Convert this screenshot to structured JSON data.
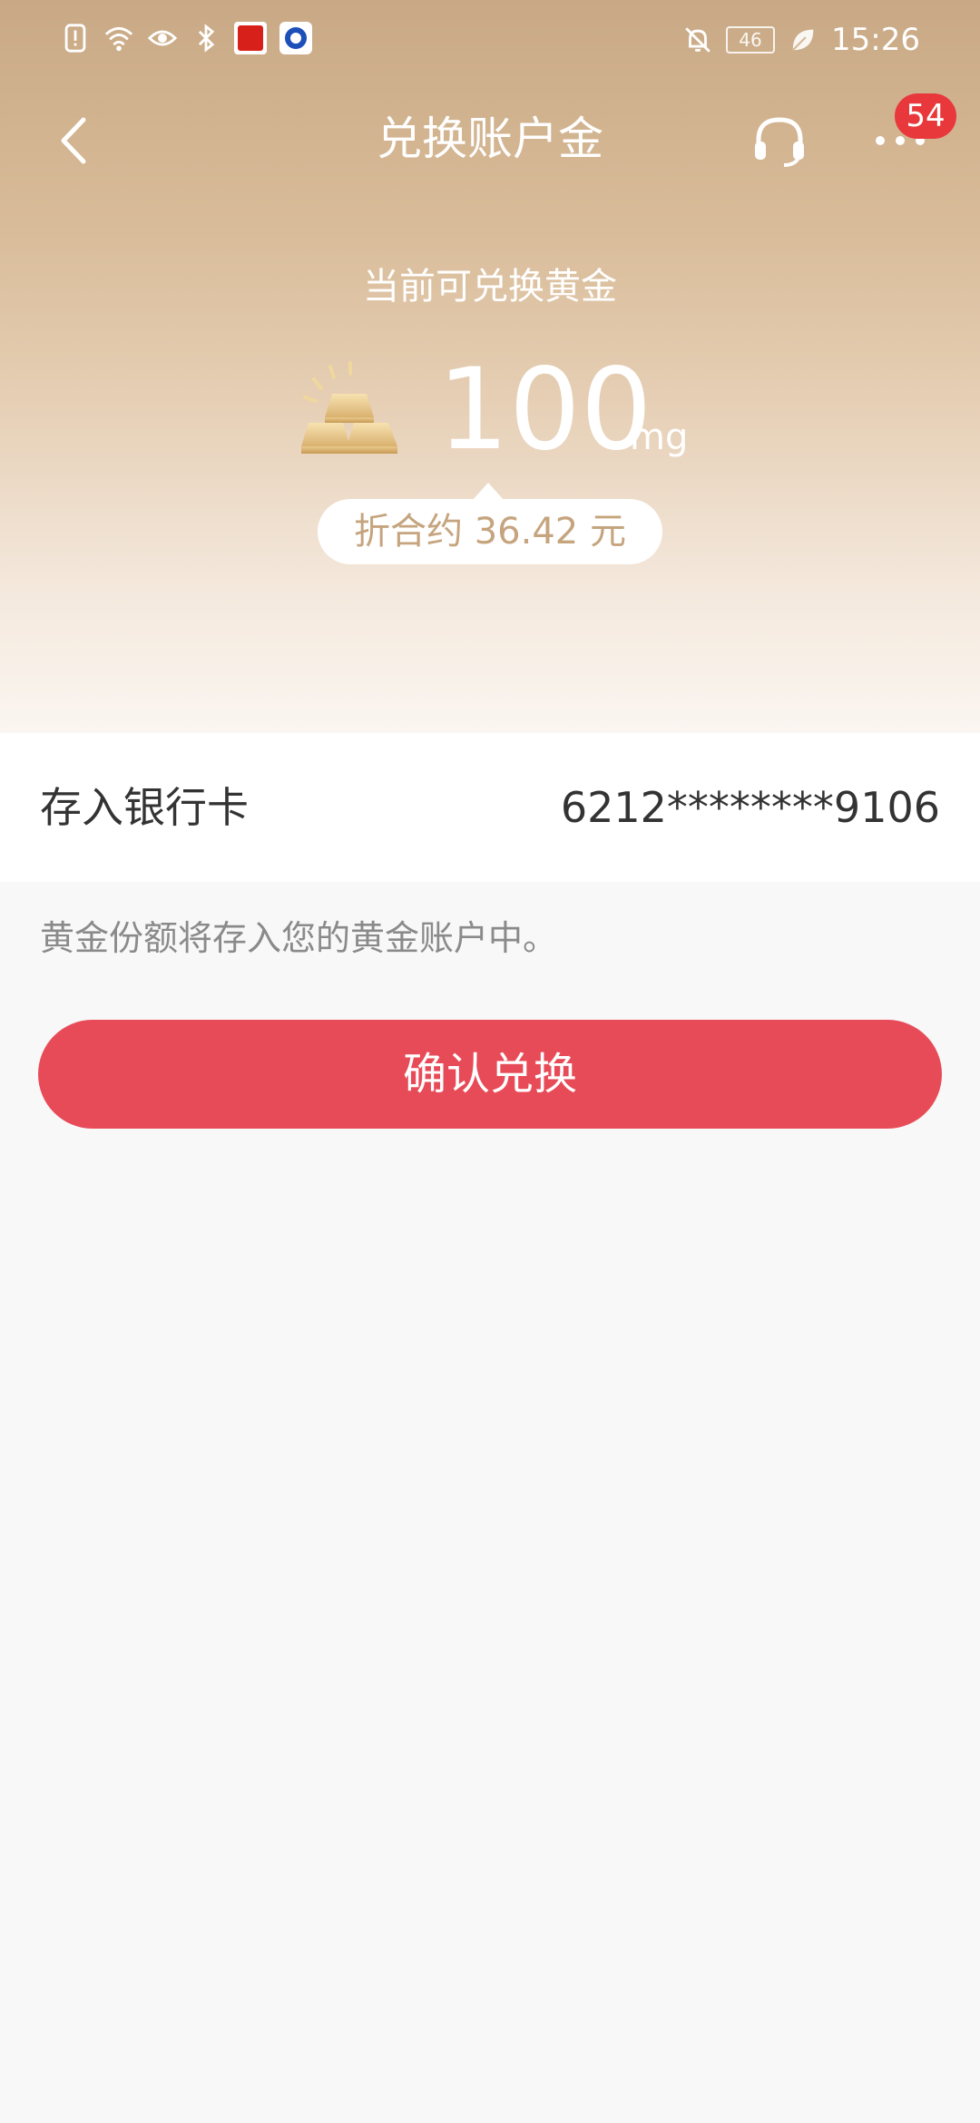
{
  "status_bar": {
    "time": "15:26",
    "battery": "46",
    "icons_left": [
      "sim-alert-icon",
      "wifi-icon",
      "eye-icon",
      "bluetooth-icon",
      "red-app-icon",
      "blue-app-icon"
    ],
    "icons_right": [
      "bell-off-icon",
      "battery-icon",
      "leaf-icon"
    ]
  },
  "nav": {
    "title": "兑换账户金",
    "badge_count": "54"
  },
  "hero": {
    "label": "当前可兑换黄金",
    "amount": "100",
    "unit": "mg",
    "equivalent": "折合约 36.42 元"
  },
  "deposit": {
    "label": "存入银行卡",
    "card_number": "6212********9106"
  },
  "hint": "黄金份额将存入您的黄金账户中。",
  "confirm_button": "确认兑换",
  "colors": {
    "primary_button": "#e84b58",
    "gold_text": "#c5a47e",
    "badge": "#e8383b"
  }
}
